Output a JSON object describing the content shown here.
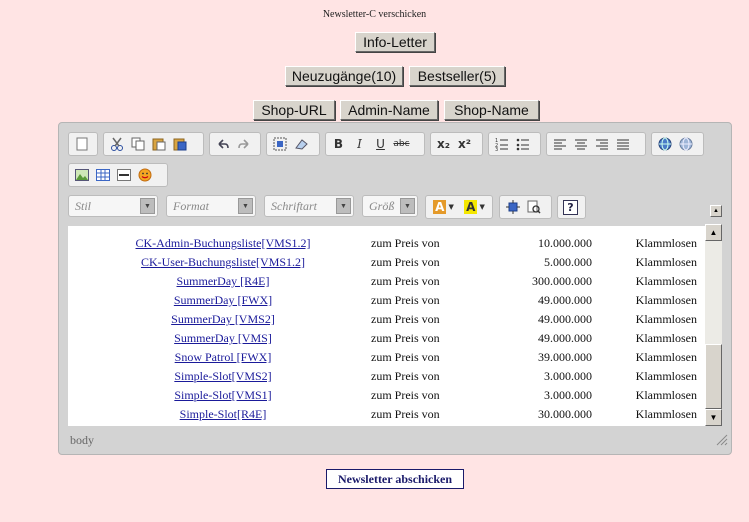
{
  "page": {
    "title": "Newsletter-C verschicken"
  },
  "buttons": {
    "info_letter": "Info-Letter",
    "neuzugaenge": "Neuzugänge(10)",
    "bestseller": "Bestseller(5)",
    "shop_url": "Shop-URL",
    "admin_name": "Admin-Name",
    "shop_name": "Shop-Name",
    "submit": "Newsletter abschicken"
  },
  "toolbar": {
    "combos": {
      "style": "Stil",
      "format": "Format",
      "font": "Schriftart",
      "size": "Größ"
    },
    "glyphs": {
      "bold": "B",
      "italic": "I",
      "underline": "U",
      "strike": "abc",
      "subscript": "x₂",
      "superscript": "x²",
      "text_color": "A",
      "bg_color": "A",
      "help": "?"
    }
  },
  "rows": [
    {
      "name": "CK-Admin-Buchungsliste[VMS1.2]",
      "price_label": "zum Preis von",
      "amount": "10.000.000",
      "currency": "Klammlosen"
    },
    {
      "name": "CK-User-Buchungsliste[VMS1.2]",
      "price_label": "zum Preis von",
      "amount": "5.000.000",
      "currency": "Klammlosen"
    },
    {
      "name": "SummerDay [R4E]",
      "price_label": "zum Preis von",
      "amount": "300.000.000",
      "currency": "Klammlosen"
    },
    {
      "name": "SummerDay [FWX]",
      "price_label": "zum Preis von",
      "amount": "49.000.000",
      "currency": "Klammlosen"
    },
    {
      "name": "SummerDay [VMS2]",
      "price_label": "zum Preis von",
      "amount": "49.000.000",
      "currency": "Klammlosen"
    },
    {
      "name": "SummerDay [VMS]",
      "price_label": "zum Preis von",
      "amount": "49.000.000",
      "currency": "Klammlosen"
    },
    {
      "name": "Snow Patrol [FWX]",
      "price_label": "zum Preis von",
      "amount": "39.000.000",
      "currency": "Klammlosen"
    },
    {
      "name": "Simple-Slot[VMS2]",
      "price_label": "zum Preis von",
      "amount": "3.000.000",
      "currency": "Klammlosen"
    },
    {
      "name": "Simple-Slot[VMS1]",
      "price_label": "zum Preis von",
      "amount": "3.000.000",
      "currency": "Klammlosen"
    },
    {
      "name": "Simple-Slot[R4E]",
      "price_label": "zum Preis von",
      "amount": "30.000.000",
      "currency": "Klammlosen"
    }
  ],
  "statusbar": {
    "path": "body"
  },
  "scrollbar": {
    "up_glyph": "▲",
    "down_glyph": "▼"
  }
}
